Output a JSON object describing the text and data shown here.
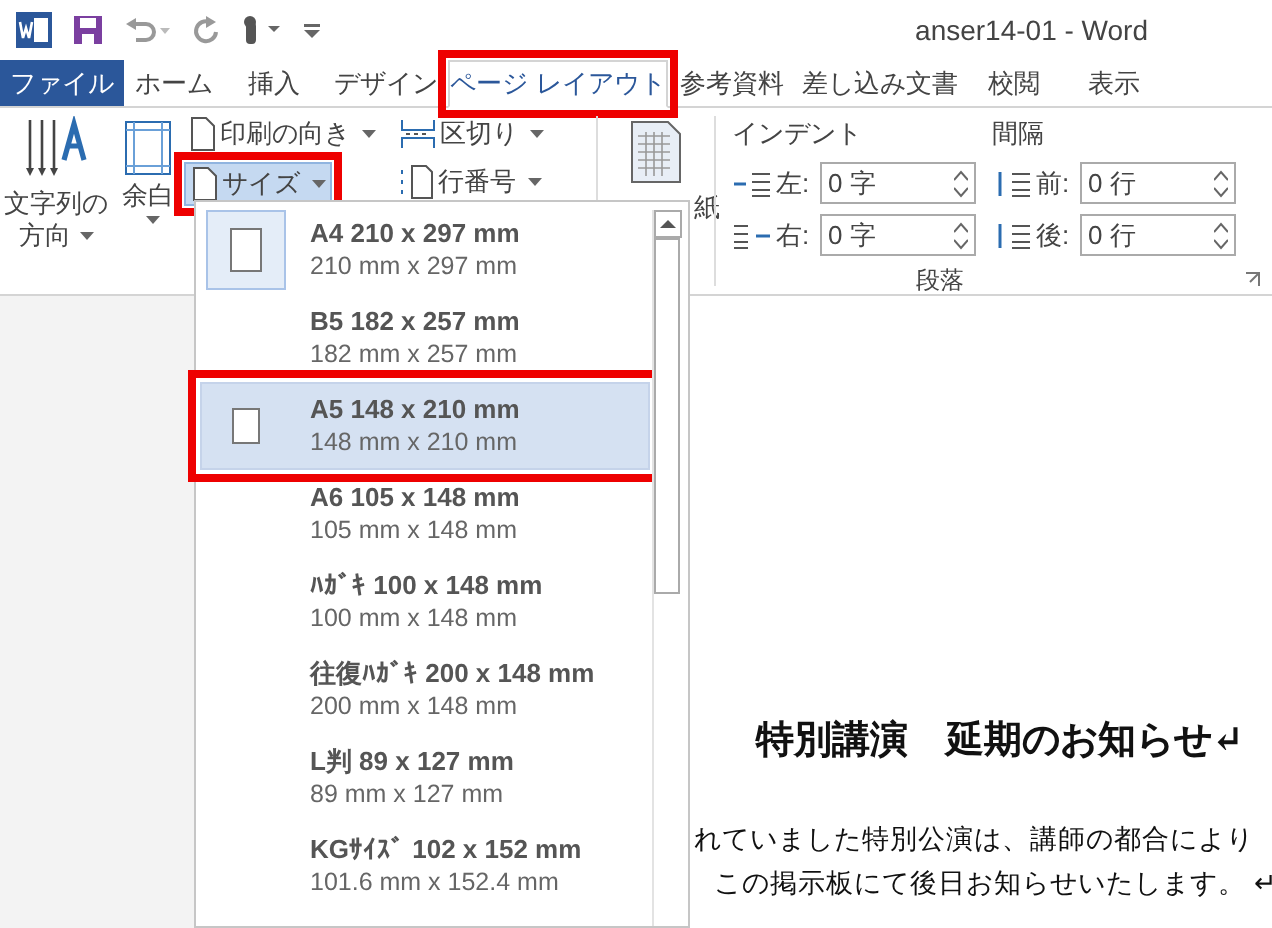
{
  "window": {
    "title": "anser14-01 - Word"
  },
  "tabs": [
    {
      "label": "ファイル",
      "kind": "file",
      "selected": false,
      "highlighted": false
    },
    {
      "label": "ホーム",
      "kind": "tab",
      "selected": false,
      "highlighted": false
    },
    {
      "label": "挿入",
      "kind": "tab",
      "selected": false,
      "highlighted": false
    },
    {
      "label": "デザイン",
      "kind": "tab",
      "selected": false,
      "highlighted": false
    },
    {
      "label": "ページ レイアウト",
      "kind": "tab",
      "selected": true,
      "highlighted": true
    },
    {
      "label": "参考資料",
      "kind": "tab",
      "selected": false,
      "highlighted": false
    },
    {
      "label": "差し込み文書",
      "kind": "tab",
      "selected": false,
      "highlighted": false
    },
    {
      "label": "校閲",
      "kind": "tab",
      "selected": false,
      "highlighted": false
    },
    {
      "label": "表示",
      "kind": "tab",
      "selected": false,
      "highlighted": false
    }
  ],
  "ribbon": {
    "text_direction": [
      "文字列の",
      "方向"
    ],
    "margins": "余白",
    "orientation": "印刷の向き",
    "size": {
      "label": "サイズ",
      "pressed": true,
      "highlighted": true
    },
    "breaks": "区切り",
    "line_numbers": "行番号",
    "genko_fragment": "紙",
    "indent": {
      "title": "インデント",
      "left_label": "左:",
      "left_value": "0 字",
      "right_label": "右:",
      "right_value": "0 字"
    },
    "spacing": {
      "title": "間隔",
      "before_label": "前:",
      "before_value": "0 行",
      "after_label": "後:",
      "after_value": "0 行"
    },
    "group_label": "段落"
  },
  "size_menu": [
    {
      "title": "A4 210 x 297 mm",
      "detail": "210 mm x 297 mm",
      "current": true,
      "selected": false,
      "highlighted": false
    },
    {
      "title": "B5 182 x 257 mm",
      "detail": "182 mm x 257 mm",
      "current": false,
      "selected": false,
      "highlighted": false
    },
    {
      "title": "A5 148 x 210 mm",
      "detail": "148 mm x 210 mm",
      "current": false,
      "selected": true,
      "highlighted": true
    },
    {
      "title": "A6 105 x 148 mm",
      "detail": "105 mm x 148 mm",
      "current": false,
      "selected": false,
      "highlighted": false
    },
    {
      "title": "ﾊｶﾞｷ 100 x 148 mm",
      "detail": "100 mm x 148 mm",
      "current": false,
      "selected": false,
      "highlighted": false
    },
    {
      "title": "往復ﾊｶﾞｷ 200 x 148 mm",
      "detail": "200 mm x 148 mm",
      "current": false,
      "selected": false,
      "highlighted": false
    },
    {
      "title": "L判 89 x 127 mm",
      "detail": "89 mm x 127 mm",
      "current": false,
      "selected": false,
      "highlighted": false
    },
    {
      "title": "KGｻｲｽﾞ 102 x 152 mm",
      "detail": "101.6 mm x 152.4 mm",
      "current": false,
      "selected": false,
      "highlighted": false
    }
  ],
  "document": {
    "heading": "特別講演　延期のお知らせ↵",
    "lines": [
      "れていました特別公演は、講師の都合により",
      "この掲示板にて後日お知らせいたします。 ↵"
    ]
  }
}
